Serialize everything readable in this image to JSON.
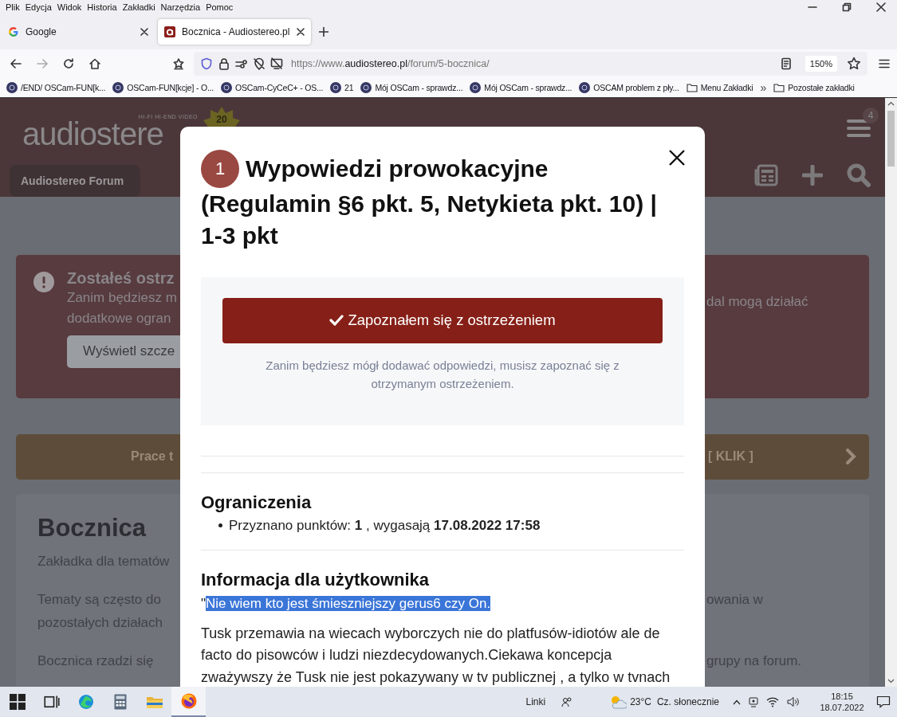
{
  "menu_bar": [
    "Plik",
    "Edycja",
    "Widok",
    "Historia",
    "Zakładki",
    "Narzędzia",
    "Pomoc"
  ],
  "tabs": [
    {
      "title": "Google",
      "selected": false
    },
    {
      "title": "Bocznica - Audiostereo.pl",
      "selected": true
    }
  ],
  "address_bar": {
    "url_prefix": "https://www.",
    "url_domain": "audiostereo.pl",
    "url_path": "/forum/5-bocznica/",
    "zoom": "150%"
  },
  "bookmarks": [
    {
      "label": "/END/ OSCam-FUN[k...",
      "kind": "site"
    },
    {
      "label": "OSCam-FUN[kcje] - O...",
      "kind": "site"
    },
    {
      "label": "OSCam-CyCeC+ - OS...",
      "kind": "site"
    },
    {
      "label": "21",
      "kind": "site"
    },
    {
      "label": "Mój OSCam - sprawdz...",
      "kind": "site"
    },
    {
      "label": "Mój OSCam - sprawdz...",
      "kind": "site"
    },
    {
      "label": "OSCAM problem z pły...",
      "kind": "site"
    },
    {
      "label": "Menu Zakładki",
      "kind": "folder"
    },
    {
      "label": "»",
      "kind": "more"
    },
    {
      "label": "Pozostałe zakładki",
      "kind": "folder"
    }
  ],
  "page": {
    "header": {
      "logo": "audiostere",
      "tagline": "HI-FI HI-END VIDEO",
      "anniversary": "20",
      "breadcrumb": "Audiostereo Forum",
      "notification_count": "4"
    },
    "warning": {
      "title": "Zostałeś ostrz",
      "lines": [
        "Zanim będziesz m",
        "dodatkowe ogran"
      ],
      "right_line": "dal mogą działać",
      "button": "Wyświetl szcze"
    },
    "banner": {
      "left": "Prace t",
      "right": "[ KLIK ]"
    },
    "forum": {
      "title": "Bocznica",
      "paragraphs": [
        {
          "left": [
            "Zakładka dla tematów"
          ]
        },
        {
          "left": [
            "Tematy są często do",
            "pozostałych działach"
          ],
          "right": [
            "owania w"
          ]
        },
        {
          "left": [
            "Bocznica rzadzi się"
          ],
          "right": [
            "grupy na forum."
          ]
        }
      ]
    }
  },
  "modal": {
    "number": "1",
    "title_lines": [
      "Wypowiedzi prowokacyjne",
      "(Regulamin §6 pkt. 5, Netykieta pkt. 10) | 1-3 pkt"
    ],
    "acknowledge_button": "Zapoznałem się z ostrzeżeniem",
    "notice": "Zanim będziesz mógł dodawać odpowiedzi, musisz zapoznać się z otrzymanym ostrzeżeniem.",
    "sections": [
      {
        "kind": "list",
        "heading": "Ograniczenia",
        "items": [
          "Przyznano punktów: **1** , wygasają **17.08.2022 17:58**"
        ]
      },
      {
        "kind": "message",
        "heading": "Informacja dla użytkownika",
        "quote_mark": "\"",
        "quote": "Nie wiem kto jest śmieszniejszy gerus6 czy On. ",
        "quote_highlighted": true,
        "paragraph": "Tusk przemawia na wiecach wyborczych nie do platfusów-idiotów ale de facto do pisowców i ludzi niezdecydowanych.Ciekawa koncepcja zważywszy że Tusk nie jest pokazywany w tv publicznej , a tylko w tvnach"
      }
    ]
  },
  "taskbar": {
    "apps": [
      {
        "kind": "start",
        "selected": false
      },
      {
        "kind": "taskview",
        "selected": false
      },
      {
        "kind": "edge",
        "selected": false
      },
      {
        "kind": "calculator",
        "selected": false
      },
      {
        "kind": "explorer",
        "selected": false
      },
      {
        "kind": "firefox",
        "selected": true
      }
    ],
    "links": "Linki",
    "temperature": "23°C",
    "weather": "Cz. słonecznie",
    "time": "18:15",
    "date": "18.07.2022"
  }
}
